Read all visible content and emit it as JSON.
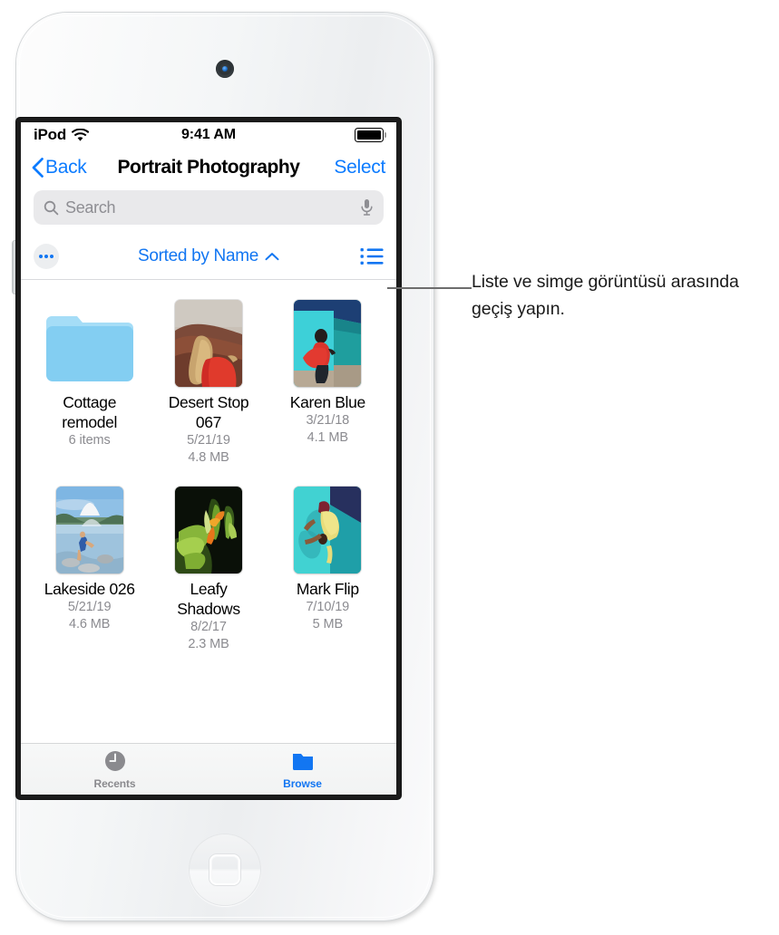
{
  "status_bar": {
    "carrier": "iPod",
    "wifi_icon": "wifi-icon",
    "time": "9:41 AM",
    "battery_icon": "battery-full-icon"
  },
  "nav_bar": {
    "back_label": "Back",
    "back_icon": "chevron-left-icon",
    "title": "Portrait Photography",
    "select_label": "Select"
  },
  "search": {
    "placeholder": "Search",
    "search_icon": "search-icon",
    "mic_icon": "microphone-icon"
  },
  "sort_bar": {
    "more_icon": "ellipsis-icon",
    "sort_label": "Sorted by Name",
    "sort_chevron_icon": "chevron-up-icon",
    "list_view_icon": "list-view-icon"
  },
  "files": [
    {
      "name": "Cottage remodel",
      "meta1": "6 items",
      "meta2": "",
      "type": "folder",
      "icon": "folder-icon"
    },
    {
      "name": "Desert Stop 067",
      "meta1": "5/21/19",
      "meta2": "4.8 MB",
      "type": "image",
      "icon": "photo-thumbnail-desert"
    },
    {
      "name": "Karen Blue",
      "meta1": "3/21/18",
      "meta2": "4.1 MB",
      "type": "image",
      "icon": "photo-thumbnail-karen-blue"
    },
    {
      "name": "Lakeside 026",
      "meta1": "5/21/19",
      "meta2": "4.6 MB",
      "type": "image",
      "icon": "photo-thumbnail-lakeside"
    },
    {
      "name": "Leafy Shadows",
      "meta1": "8/2/17",
      "meta2": "2.3 MB",
      "type": "image",
      "icon": "photo-thumbnail-leafy-shadows"
    },
    {
      "name": "Mark Flip",
      "meta1": "7/10/19",
      "meta2": "5 MB",
      "type": "image",
      "icon": "photo-thumbnail-mark-flip"
    }
  ],
  "tab_bar": {
    "tabs": [
      {
        "label": "Recents",
        "icon": "clock-icon",
        "active": false
      },
      {
        "label": "Browse",
        "icon": "folder-icon",
        "active": true
      }
    ]
  },
  "callout": {
    "text": "Liste ve simge görüntüsü arasında geçiş yapın."
  },
  "colors": {
    "accent_blue": "#1276f2",
    "nav_blue": "#0b7bff",
    "folder_blue": "#8ad4f5",
    "meta_gray": "#8b8b90",
    "leader_gray": "#6d6d6d"
  }
}
